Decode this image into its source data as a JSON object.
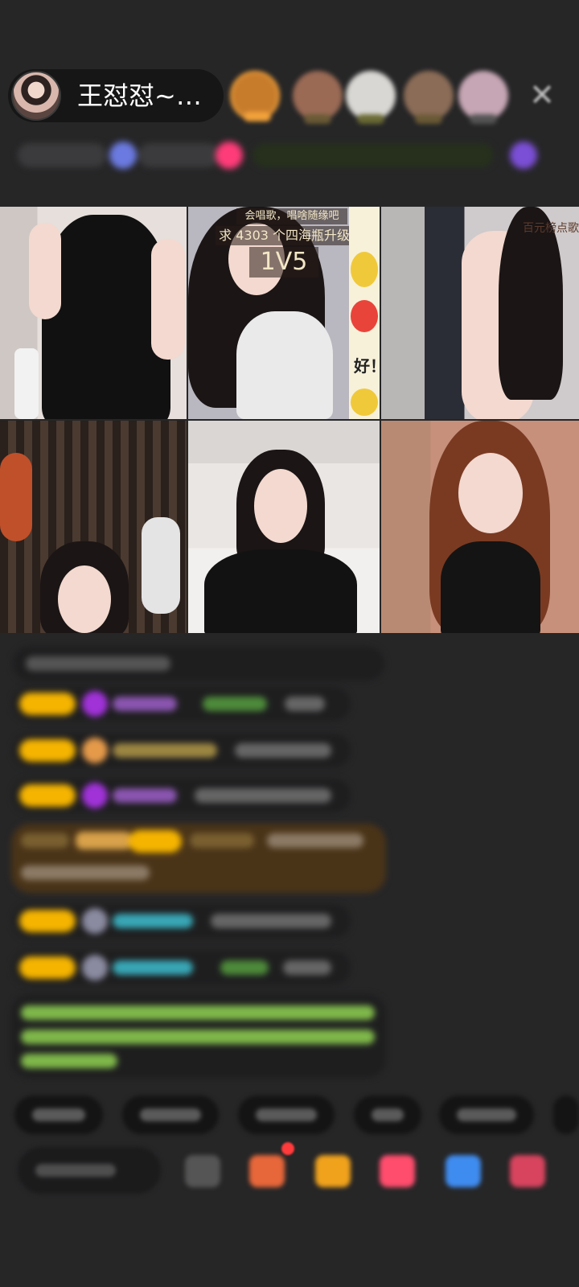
{
  "header": {
    "host_name": "王怼怼~…",
    "close_label": "✕",
    "viewers": [
      {
        "name": "viewer-1",
        "color": "#c77c2c",
        "ring": "#f3a23a"
      },
      {
        "name": "viewer-2",
        "color": "#9a6a55",
        "ring": "#3b3b3b"
      },
      {
        "name": "viewer-3",
        "color": "#d9d7d3",
        "ring": "#3b3b3b"
      },
      {
        "name": "viewer-4",
        "color": "#8b6c57",
        "ring": "#3b3b3b"
      },
      {
        "name": "viewer-5",
        "color": "#c6a6b4",
        "ring": "#3b3b3b"
      }
    ]
  },
  "video_grid": {
    "tile2_line1": "会唱歌，唱啥随缘吧",
    "tile2_line2": "求 4303 个四海瓶升级~~",
    "tile2_vs": "1V5",
    "tile2_sticker_text": "好！",
    "tile3_label": "百元榜点歌"
  },
  "colors": {
    "background": "#262627",
    "badge_yellow": "#f5b400",
    "gem_purple": "#a032d8",
    "green_text": "#7fb84a",
    "cyan_text": "#38a6b5",
    "highlight_bg": "#4a3418"
  },
  "toolbar_icons": [
    "emoji-icon",
    "gift-box-icon",
    "treasure-icon",
    "heart-icon",
    "game-icon",
    "store-icon"
  ]
}
